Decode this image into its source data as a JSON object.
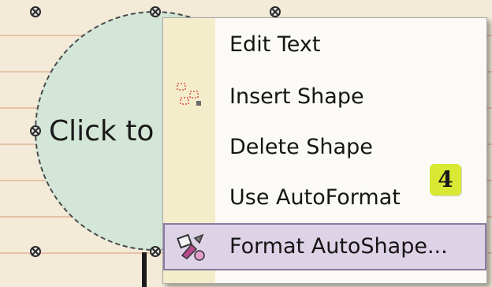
{
  "menu": {
    "items": [
      {
        "label": "Edit Text",
        "icon": ""
      },
      {
        "label": "Insert Shape",
        "icon": "insert-shape-icon"
      },
      {
        "label": "Delete Shape",
        "icon": ""
      },
      {
        "label": "Use AutoFormat",
        "icon": ""
      },
      {
        "label": "Format AutoShape...",
        "icon": "format-autoshape-icon",
        "highlighted": true
      }
    ]
  },
  "shape": {
    "text": "Click to a"
  },
  "callout": {
    "number": "4"
  },
  "colors": {
    "shape_fill": "#d4e6d7",
    "menu_gutter": "#f4edcb",
    "highlight": "#ddd2e6",
    "badge": "#d9e832"
  }
}
